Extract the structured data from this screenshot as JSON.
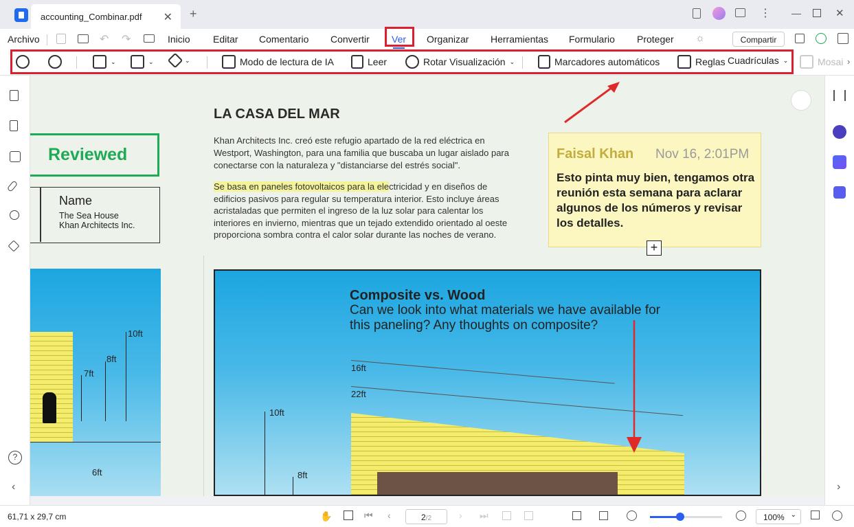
{
  "titlebar": {
    "tab_title": "accounting_Combinar.pdf",
    "close": "✕",
    "new_tab": "+"
  },
  "menubar": {
    "archivo": "Archivo",
    "items": [
      "Inicio",
      "Editar",
      "Comentario",
      "Convertir",
      "Ver",
      "Organizar",
      "Herramientas",
      "Formulario",
      "Proteger"
    ],
    "active": "Ver",
    "share": "Compartir"
  },
  "toolbar": {
    "ai_reading": "Modo de lectura de IA",
    "read": "Leer",
    "rotate": "Rotar Visualización",
    "auto_bookmarks": "Marcadores automáticos",
    "rulers": "Reglas",
    "grids": "Cuadrículas",
    "mosaic": "Mosai"
  },
  "page": {
    "stamp": "Reviewed",
    "name_label": "Name",
    "name_line1": "The Sea House",
    "name_line2": "Khan Architects Inc.",
    "heading": "LA CASA DEL MAR",
    "para1": "Khan Architects Inc. creó este refugio apartado de la red eléctrica en Westport, Washington, para una familia que buscaba un lugar aislado para conectarse con la naturaleza y \"distanciarse del estrés social\".",
    "para2_highlight": "Se basa en paneles fotovoltaicos para la ele",
    "para2_rest": "ctricidad y en diseños de edificios pasivos para regular su temperatura interior. Esto incluye áreas acristaladas que permiten el ingreso de la luz solar para calentar los interiores en invierno, mientras que un tejado extendido orientado al oeste proporciona sombra contra el calor solar durante las noches de verano.",
    "note_author": "Faisal Khan",
    "note_date": "Nov 16, 2:01PM",
    "note_text": "Esto pinta muy bien, tengamos otra reunión esta semana para aclarar algunos de los números y revisar los detalles.",
    "callout_title": "Composite vs. Wood",
    "callout_text": "Can we look into what materials we have available for this paneling? Any thoughts on composite?",
    "dims_left": [
      "10ft",
      "8ft",
      "7ft",
      "6ft"
    ],
    "dims_right": [
      "16ft",
      "22ft",
      "10ft",
      "8ft"
    ]
  },
  "status": {
    "dimensions": "61,71 x 29,7 cm",
    "page_current": "2",
    "page_total": "/2",
    "zoom": "100%"
  },
  "colors": {
    "accent": "#2c5cf2",
    "highlight_box": "#dc1f2e",
    "stamp_green": "#1faa55",
    "note_bg": "#fcf6c0"
  },
  "sidebar_icons": [
    "page-icon",
    "bookmark-icon",
    "comment-icon",
    "attachment-icon",
    "search-icon",
    "layers-icon",
    "help-icon"
  ]
}
